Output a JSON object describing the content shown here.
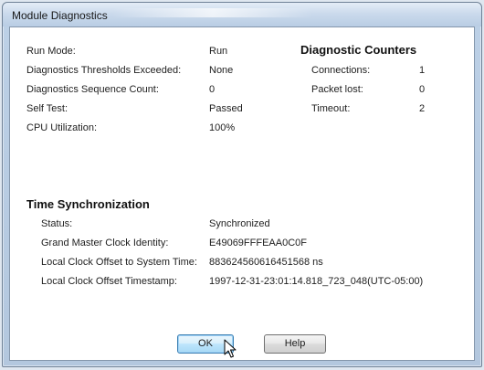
{
  "window": {
    "title": "Module Diagnostics"
  },
  "general": [
    {
      "label": "Run Mode:",
      "value": "Run"
    },
    {
      "label": "Diagnostics Thresholds Exceeded:",
      "value": "None"
    },
    {
      "label": "Diagnostics Sequence Count:",
      "value": "0"
    },
    {
      "label": "Self Test:",
      "value": "Passed"
    },
    {
      "label": "CPU Utilization:",
      "value": "100%"
    }
  ],
  "counters": {
    "heading": "Diagnostic Counters",
    "items": [
      {
        "label": "Connections:",
        "value": "1"
      },
      {
        "label": "Packet lost:",
        "value": "0"
      },
      {
        "label": "Timeout:",
        "value": "2"
      }
    ]
  },
  "time_sync": {
    "heading": "Time Synchronization",
    "items": [
      {
        "label": "Status:",
        "value": "Synchronized"
      },
      {
        "label": "Grand Master Clock Identity:",
        "value": "E49069FFFEAA0C0F"
      },
      {
        "label": "Local Clock Offset to System Time:",
        "value": "883624560616451568 ns"
      },
      {
        "label": "Local Clock Offset Timestamp:",
        "value": "1997-12-31-23:01:14.818_723_048(UTC-05:00)"
      }
    ]
  },
  "buttons": {
    "ok": "OK",
    "help": "Help"
  }
}
